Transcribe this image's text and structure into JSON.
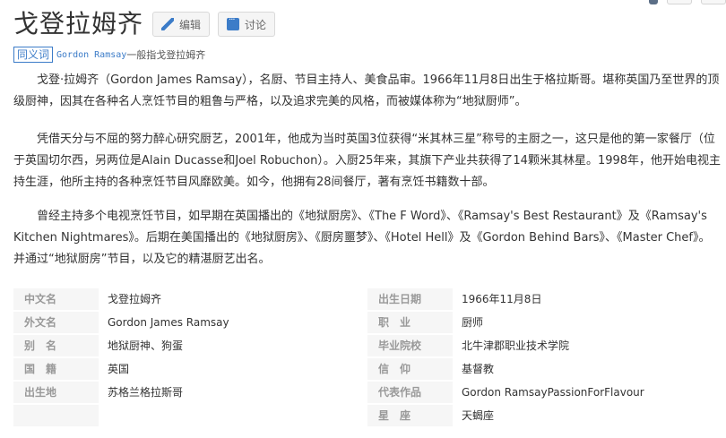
{
  "title": "戈登拉姆齐",
  "buttons": {
    "edit": "编辑",
    "discuss": "讨论"
  },
  "synonym": {
    "tag": "同义词",
    "link": "Gordon Ramsay",
    "text": "一般指戈登拉姆齐"
  },
  "paragraphs": [
    "戈登·拉姆齐（Gordon James Ramsay），名厨、节目主持人、美食品审。1966年11月8日出生于格拉斯哥。堪称英国乃至世界的顶级厨神，因其在各种名人烹饪节目的粗鲁与严格，以及追求完美的风格，而被媒体称为“地狱厨师”。",
    "凭借天分与不屈的努力醉心研究厨艺，2001年，他成为当时英国3位获得“米其林三星”称号的主厨之一，这只是他的第一家餐厅（位于英国切尔西，另两位是Alain Ducasse和Joel Robuchon）。入厨25年来，其旗下产业共获得了14颗米其林星。1998年，他开始电视主持生涯，他所主持的各种烹饪节目风靡欧美。如今，他拥有28间餐厅，著有烹饪书籍数十部。",
    "曾经主持多个电视烹饪节目，如早期在英国播出的《地狱厨房》、《The F Word》、《Ramsay's Best Restaurant》及《Ramsay's Kitchen Nightmares》。后期在美国播出的《地狱厨房》、《厨房噩梦》、《Hotel Hell》及《Gordon Behind Bars》、《Master Chef》。并通过“地狱厨房”节目，以及它的精湛厨艺出名。"
  ],
  "info": {
    "left": [
      {
        "key": "中文名",
        "value": "戈登拉姆齐"
      },
      {
        "key": "外文名",
        "value": "Gordon James Ramsay"
      },
      {
        "key": "别　名",
        "value": "地狱厨神、狗蛋"
      },
      {
        "key": "国　籍",
        "value": "英国"
      },
      {
        "key": "出生地",
        "value": "苏格兰格拉斯哥"
      }
    ],
    "right": [
      {
        "key": "出生日期",
        "value": "1966年11月8日"
      },
      {
        "key": "职　业",
        "value": "厨师"
      },
      {
        "key": "毕业院校",
        "value": "北牛津郡职业技术学院"
      },
      {
        "key": "信　仰",
        "value": "基督教"
      },
      {
        "key": "代表作品",
        "value": "Gordon RamsayPassionForFlavour"
      },
      {
        "key": "星　座",
        "value": "天蝎座"
      }
    ]
  }
}
